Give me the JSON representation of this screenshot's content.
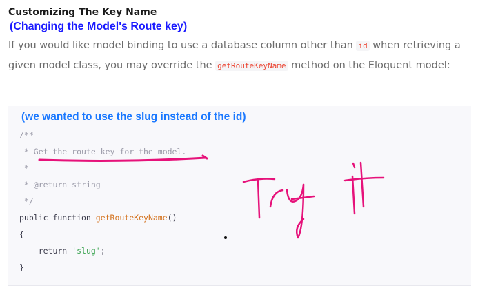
{
  "heading": "Customizing The Key Name",
  "annotation_blue": "(Changing the Model's Route key)",
  "paragraph": {
    "part1": "If you would like model binding to use a database column other than ",
    "code1": "id",
    "part2": " when retrieving a given model class, you may override the ",
    "code2": "getRouteKeyName",
    "part3": " method on the Eloquent model:"
  },
  "annotation_slug": "(we wanted to use the slug instead of the id)",
  "code": {
    "l1": "/**",
    "l2": " * Get the route key for the model.",
    "l3": " *",
    "l4": " * @return string",
    "l5": " */",
    "l6_kw": "public function ",
    "l6_fn": "getRouteKeyName",
    "l6_end": "()",
    "l7": "{",
    "l8_kw": "    return ",
    "l8_str": "'slug'",
    "l8_end": ";",
    "l9": "}"
  },
  "handwriting": "Try it",
  "colors": {
    "annotation_pink": "#e6127a",
    "annotation_blue": "#1a1aff",
    "annotation_light_blue": "#1a78ff"
  }
}
